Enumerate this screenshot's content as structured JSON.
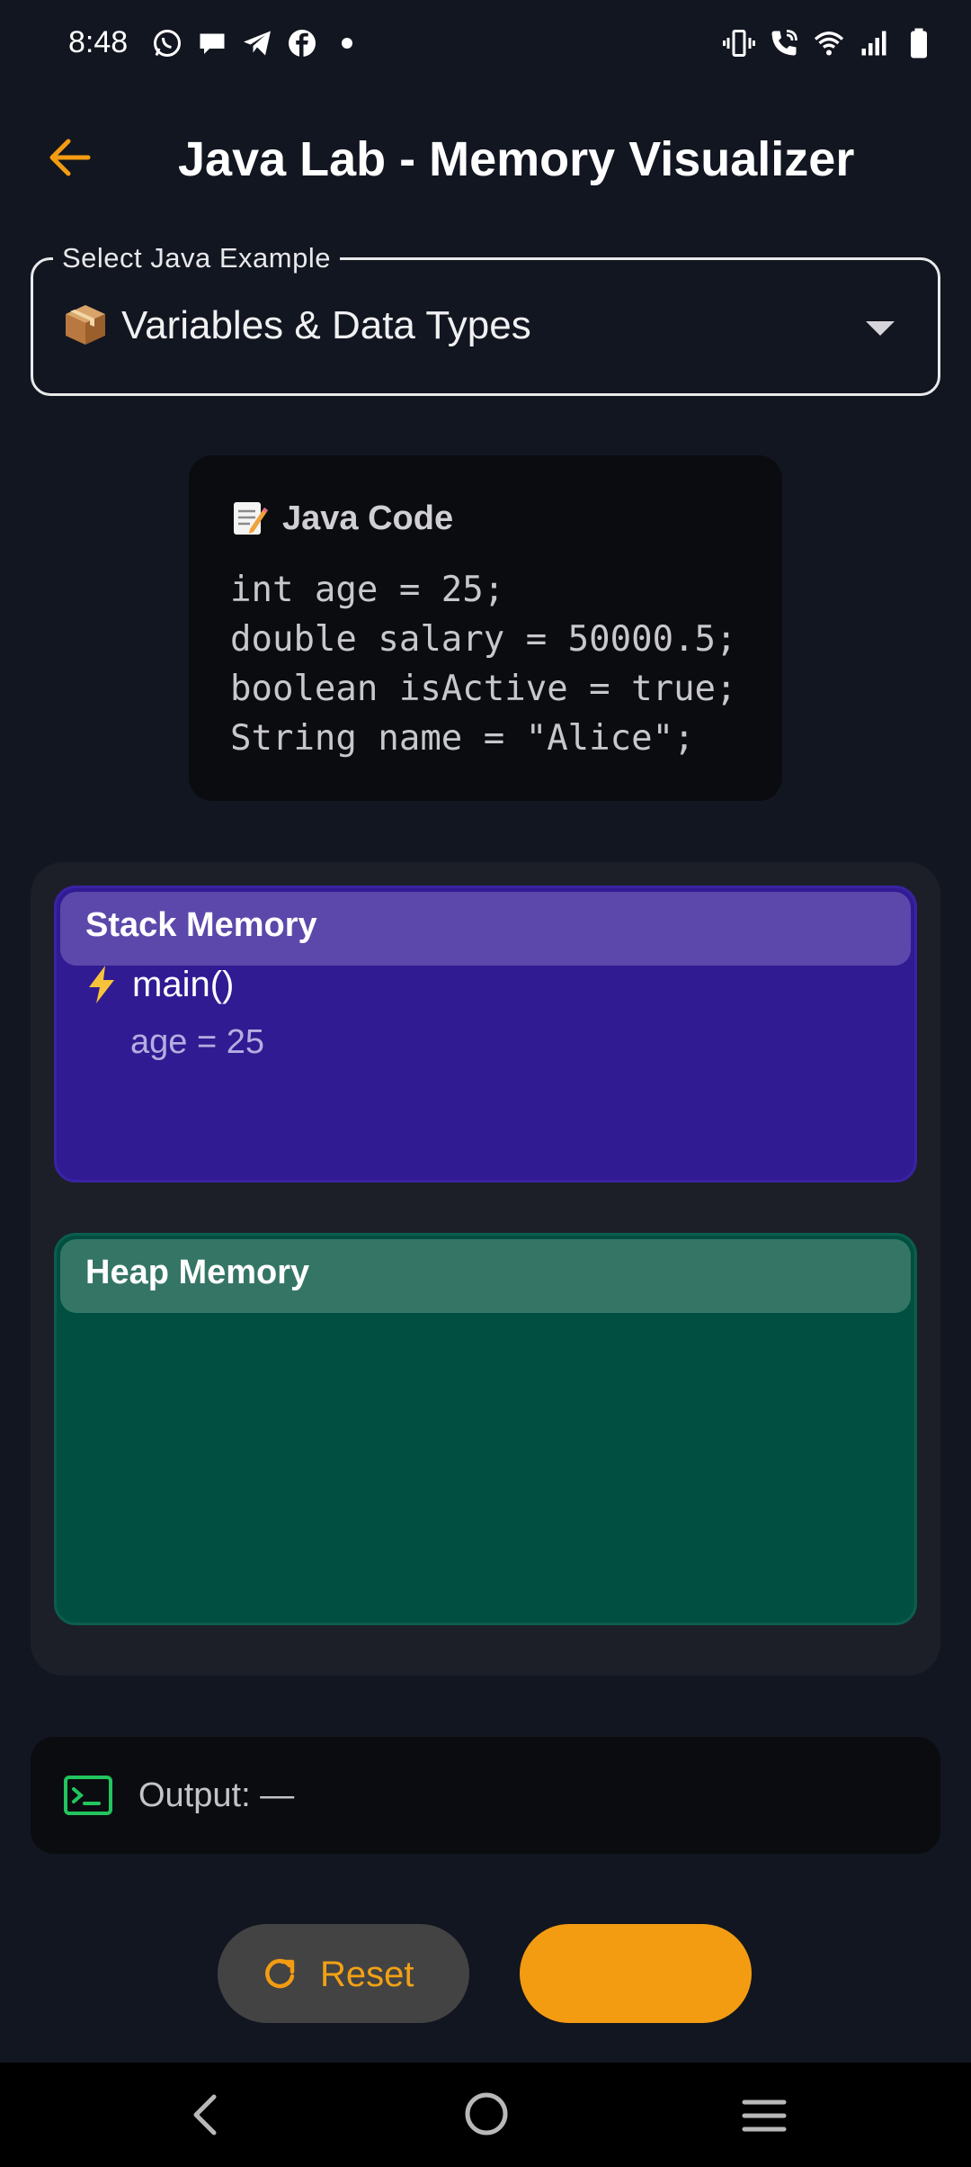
{
  "status_bar": {
    "time": "8:48",
    "left_icons": [
      "whatsapp-icon",
      "chat-bubble-icon",
      "telegram-icon",
      "facebook-icon",
      "dot-icon"
    ],
    "right_icons": [
      "vibrate-icon",
      "wifi-call-icon",
      "wifi-icon",
      "signal-icon",
      "battery-icon"
    ]
  },
  "app_bar": {
    "back_icon": "arrow-left-icon",
    "title": "Java Lab - Memory Visualizer",
    "accent_color": "#F39C12"
  },
  "example_select": {
    "label": "Select Java Example",
    "selected_emoji": "package-icon",
    "selected_value": "Variables & Data Types"
  },
  "code_card": {
    "icon": "memo-icon",
    "title": "Java Code",
    "lines": [
      "int age = 25;",
      "double salary = 50000.5;",
      "boolean isActive = true;",
      "String name = \"Alice\";"
    ]
  },
  "memory": {
    "stack": {
      "title": "Stack Memory",
      "color": "#301B93",
      "frames": [
        {
          "icon": "lightning-icon",
          "name": "main()",
          "variables": [
            "age = 25"
          ]
        }
      ]
    },
    "heap": {
      "title": "Heap Memory",
      "color": "#004F40",
      "objects": []
    }
  },
  "output": {
    "icon": "terminal-icon",
    "label": "Output: —"
  },
  "controls": {
    "reset_label": "Reset",
    "reset_icon": "refresh-icon",
    "primary_label": ""
  },
  "nav_bar": {
    "icons": [
      "nav-back-icon",
      "nav-home-icon",
      "nav-recents-icon"
    ]
  }
}
